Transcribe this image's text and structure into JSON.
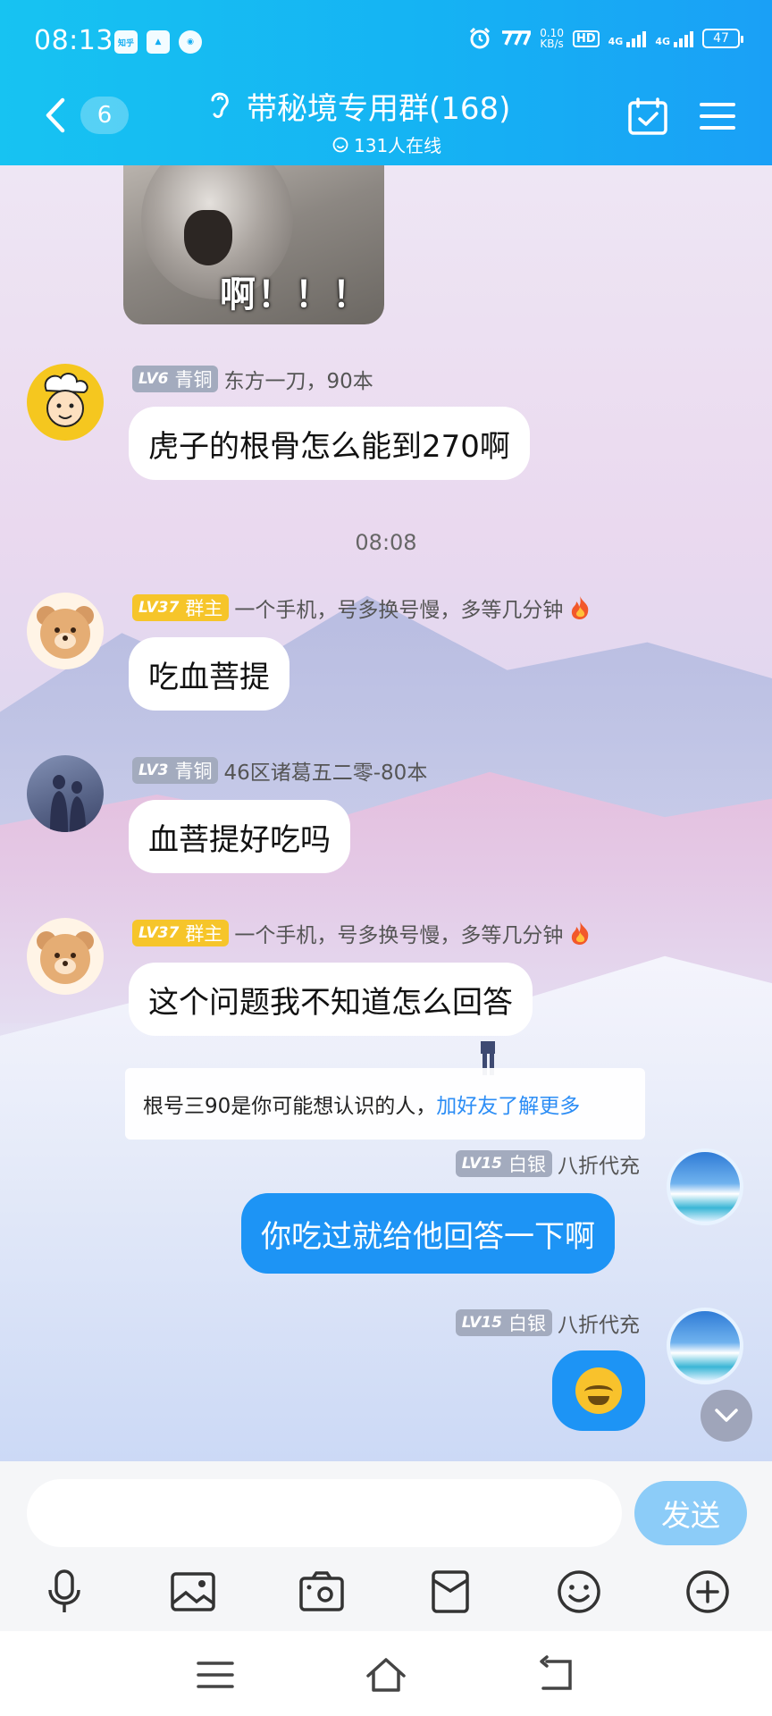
{
  "status_bar": {
    "time": "08:13",
    "apps": [
      "知乎",
      "▲",
      "◉"
    ],
    "net_speed_value": "0.10",
    "net_speed_unit": "KB/s",
    "hd": "HD",
    "sim1": "4G",
    "sim2": "4G",
    "battery": "47"
  },
  "header": {
    "unread_count": "6",
    "group_name": "带秘境专用群(168)",
    "online_text": "131人在线"
  },
  "sticker": {
    "text": "啊！！！",
    "icon": "cat-sticker"
  },
  "messages": [
    {
      "level": "LV6",
      "title": "青铜",
      "nickname": "东方一刀，90本",
      "text": "虎子的根骨怎么能到270啊"
    },
    {
      "level": "LV37",
      "title": "群主",
      "nickname": "一个手机，号多换号慢，多等几分钟",
      "text": "吃血菩提"
    },
    {
      "level": "LV3",
      "title": "青铜",
      "nickname": "46区诸葛五二零-80本",
      "text": "血菩提好吃吗"
    },
    {
      "level": "LV37",
      "title": "群主",
      "nickname": "一个手机，号多换号慢，多等几分钟",
      "text": "这个问题我不知道怎么回答"
    },
    {
      "level": "LV15",
      "title": "白银",
      "nickname": "八折代充",
      "text": "你吃过就给他回答一下啊"
    },
    {
      "level": "LV15",
      "title": "白银",
      "nickname": "八折代充",
      "text": ""
    }
  ],
  "timestamp": "08:08",
  "notice": {
    "text": "根号三90是你可能想认识的人，",
    "link": "加好友了解更多"
  },
  "composer": {
    "placeholder": "",
    "send_label": "发送"
  },
  "toolbar_icons": [
    "microphone-icon",
    "image-icon",
    "camera-icon",
    "red-packet-icon",
    "emoji-icon",
    "plus-icon"
  ],
  "colors": {
    "header": "#15b3f3",
    "my_bubble": "#1d94f5",
    "link": "#2c8df5",
    "send_button": "#8cccf8",
    "badge_gold": "#f6c52a",
    "badge_gray": "#a3abbe"
  }
}
